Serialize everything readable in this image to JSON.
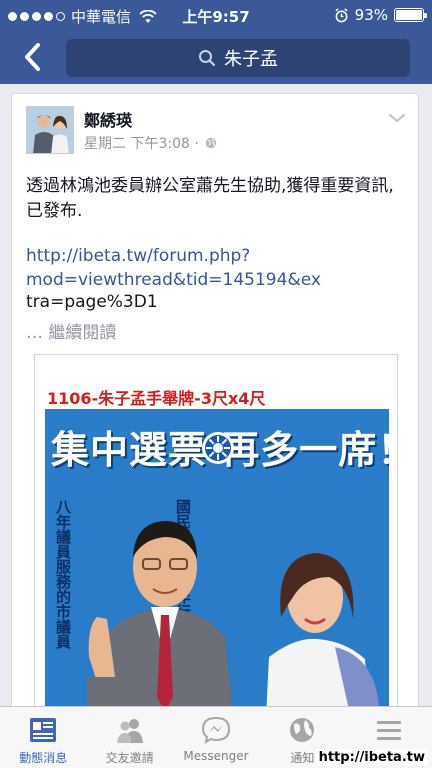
{
  "status_bar": {
    "carrier": "中華電信",
    "time": "上午9:57",
    "battery": "93%",
    "battery_level": 0.93
  },
  "nav": {
    "search_query": "朱子孟"
  },
  "post": {
    "author": "鄭綉瑛",
    "timestamp": "星期二 下午3:08 ·",
    "text": "透過林鴻池委員辦公室蕭先生協助,獲得重要資訊,已發布.",
    "link_line1": "http://ibeta.tw/forum.php?",
    "link_line2": "mod=viewthread&tid=145194&ex",
    "link_line3": "tra=page%3D1",
    "more": "… 繼續閱讀"
  },
  "poster": {
    "heading": "1106-朱子孟手舉牌-3尺x4尺",
    "slogan": "集中選票  再多一席！",
    "vertical_1": "國民黨唯一四年行政經驗",
    "vertical_2": "八年議員服務的市議員"
  },
  "tabs": [
    {
      "label": "動態消息",
      "icon": "news-feed-icon",
      "active": true
    },
    {
      "label": "交友邀請",
      "icon": "friends-icon",
      "active": false
    },
    {
      "label": "Messenger",
      "icon": "messenger-icon",
      "active": false
    },
    {
      "label": "通知",
      "icon": "globe-icon",
      "active": false
    },
    {
      "label": "",
      "icon": "menu-icon",
      "active": false
    }
  ],
  "watermark": "http://ibeta.tw",
  "colors": {
    "facebook_blue": "#3b5998",
    "link": "#365899",
    "poster_red": "#d21f1f",
    "poster_blue": "#2a7bc8"
  }
}
